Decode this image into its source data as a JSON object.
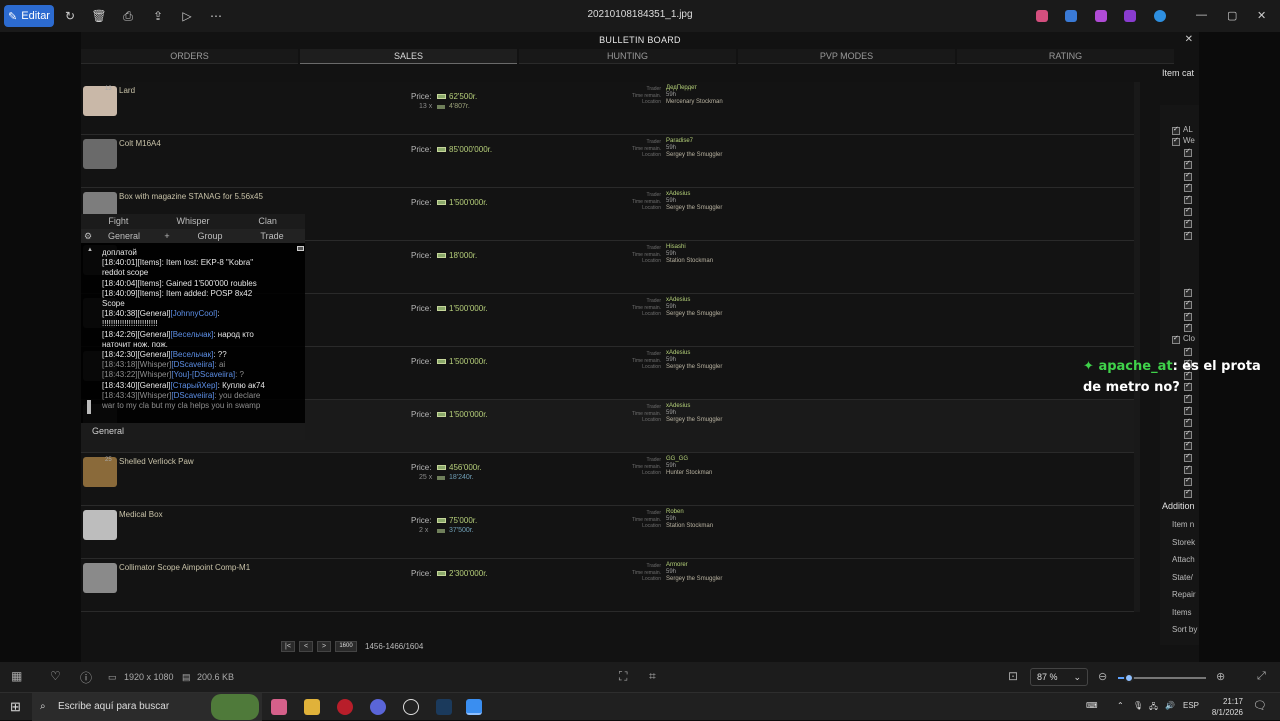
{
  "topbar": {
    "edit_label": "Editar",
    "file_title": "20210108184351_1.jpg"
  },
  "game": {
    "board_title": "BULLETIN BOARD",
    "tabs": [
      "ORDERS",
      "SALES",
      "HUNTING",
      "PVP MODES",
      "RATING"
    ],
    "active_tab": "SALES",
    "right_panel_header": "Item cat",
    "right_labels": [
      "AL",
      "We",
      "Clo"
    ],
    "additional": {
      "header": "Addition",
      "items": [
        "Item n",
        "Storek",
        "Attach",
        "State/",
        "Repair",
        "Items",
        "Sort by"
      ]
    },
    "trader_labels": [
      "Trader",
      "Time remain.",
      "Location"
    ],
    "price_label": "Price:",
    "items": [
      {
        "qty": "13",
        "name": "Lard",
        "price": "62'500r.",
        "sub_qty": "13 x",
        "sub_price": "4'807r.",
        "trader": "ДедПердет",
        "time": "59h",
        "location": "Mercenary Stockman",
        "color": "#c9b8a8",
        "hl": false
      },
      {
        "qty": "",
        "name": "Colt M16A4",
        "price": "85'000'000r.",
        "sub_qty": "",
        "sub_price": "",
        "trader": "Paradise7",
        "time": "59h",
        "location": "Sergey the Smuggler",
        "color": "#6a6a6a",
        "hl": false
      },
      {
        "qty": "",
        "name": "Box with magazine STANAG for 5.56x45",
        "price": "1'500'000r.",
        "sub_qty": "",
        "sub_price": "",
        "trader": "xAdesius",
        "time": "59h",
        "location": "Sergey the Smuggler",
        "color": "#7d7d7d",
        "hl": false
      },
      {
        "qty": "",
        "name": "",
        "price": "18'000r.",
        "sub_qty": "",
        "sub_price": "",
        "trader": "Hisashi",
        "time": "59h",
        "location": "Station Stockman",
        "color": "#555555",
        "hl": false
      },
      {
        "qty": "",
        "name": "",
        "price": "1'500'000r.",
        "sub_qty": "",
        "sub_price": "",
        "trader": "xAdesius",
        "time": "59h",
        "location": "Sergey the Smuggler",
        "color": "#555555",
        "hl": false
      },
      {
        "qty": "",
        "name": "",
        "price": "1'500'000r.",
        "sub_qty": "",
        "sub_price": "",
        "trader": "xAdesius",
        "time": "59h",
        "location": "Sergey the Smuggler",
        "color": "#555555",
        "hl": false
      },
      {
        "qty": "",
        "name": "",
        "price": "1'500'000r.",
        "sub_qty": "",
        "sub_price": "",
        "trader": "xAdesius",
        "time": "59h",
        "location": "Sergey the Smuggler",
        "color": "#555555",
        "hl": true
      },
      {
        "qty": "25",
        "name": "Shelled Verliock Paw",
        "price": "456'000r.",
        "sub_qty": "25 x",
        "sub_price": "18'240r.",
        "trader": "GG_GG",
        "time": "59h",
        "location": "Hunter Stockman",
        "color": "#8a6a3a",
        "hl": false
      },
      {
        "qty": "",
        "name": "Medical Box",
        "price": "75'000r.",
        "sub_qty": "2 x",
        "sub_price": "37'500r.",
        "trader": "Roben",
        "time": "59h",
        "location": "Station Stockman",
        "color": "#bdbdbd",
        "hl": false
      },
      {
        "qty": "",
        "name": "Collimator Scope Aimpoint Comp-M1",
        "price": "2'300'000r.",
        "sub_qty": "",
        "sub_price": "",
        "trader": "Armorer",
        "time": "59h",
        "location": "Sergey the Smuggler",
        "color": "#8a8a8a",
        "hl": false
      }
    ],
    "chat": {
      "tabs_top": [
        "Fight",
        "Whisper",
        "Clan"
      ],
      "tabs_bottom": [
        "General",
        "+",
        "Group",
        "Trade"
      ],
      "footer": "General",
      "lines": [
        [
          {
            "t": "доплатой",
            "c": ""
          }
        ],
        [
          {
            "t": "[18:40:01][Items]: Item lost: EKP-8 \"Kobra\"",
            "c": ""
          }
        ],
        [
          {
            "t": "reddot scope",
            "c": ""
          }
        ],
        [
          {
            "t": "[18:40:04][Items]: Gained 1'500'000 roubles",
            "c": ""
          }
        ],
        [
          {
            "t": "[18:40:09][Items]: Item added: POSP 8x42",
            "c": ""
          }
        ],
        [
          {
            "t": "Scope",
            "c": ""
          }
        ],
        [
          {
            "t": "[18:40:38][General]",
            "c": ""
          },
          {
            "t": "[JohnnyCool]",
            "c": "c-blue"
          },
          {
            "t": ":",
            "c": ""
          }
        ],
        [
          {
            "t": "!!!!!!!!!!!!!!!!!!!!!!!!!",
            "c": ""
          }
        ],
        [
          {
            "t": "[18:42:26][General]",
            "c": ""
          },
          {
            "t": "[Весельчак]",
            "c": "c-blue"
          },
          {
            "t": ": народ кто",
            "c": ""
          }
        ],
        [
          {
            "t": "наточит нож. пож.",
            "c": ""
          }
        ],
        [
          {
            "t": "[18:42:30][General]",
            "c": ""
          },
          {
            "t": "[Весельчак]",
            "c": "c-blue"
          },
          {
            "t": ": ??",
            "c": ""
          }
        ],
        [
          {
            "t": "[18:43:18][Whisper]",
            "c": "c-grey"
          },
          {
            "t": "[DScaveiira]",
            "c": "c-blue"
          },
          {
            "t": ": ai",
            "c": "c-grey"
          }
        ],
        [
          {
            "t": "[18:43:22][Whisper]",
            "c": "c-grey"
          },
          {
            "t": "[You]-[DScaveiira]",
            "c": "c-blue"
          },
          {
            "t": ": ?",
            "c": "c-grey"
          }
        ],
        [
          {
            "t": "[18:43:40][General]",
            "c": ""
          },
          {
            "t": "[СтарыйХер]",
            "c": "c-blue"
          },
          {
            "t": ": Куплю ак74",
            "c": ""
          }
        ],
        [
          {
            "t": "[18:43:43][Whisper]",
            "c": "c-grey"
          },
          {
            "t": "[DScaveiira]",
            "c": "c-blue"
          },
          {
            "t": ": you declare",
            "c": "c-grey"
          }
        ],
        [
          {
            "t": "war to my cla but my cla helps you in swamp",
            "c": "c-grey"
          }
        ]
      ]
    },
    "pager": {
      "first": "|<",
      "prev": "<",
      "next": ">",
      "page_input": "1600",
      "range": "1456-1466/1604"
    }
  },
  "stream": {
    "user": "apache_at",
    "message": ": es el prota de metro no?"
  },
  "infobar": {
    "resolution": "1920 x 1080",
    "filesize": "200.6 KB",
    "zoom": "87 %",
    "zoom_fraction": 0.12
  },
  "taskbar": {
    "search_placeholder": "Escribe aquí para buscar",
    "lang": "ESP",
    "time": "21:17",
    "date": "8/1/2026"
  }
}
